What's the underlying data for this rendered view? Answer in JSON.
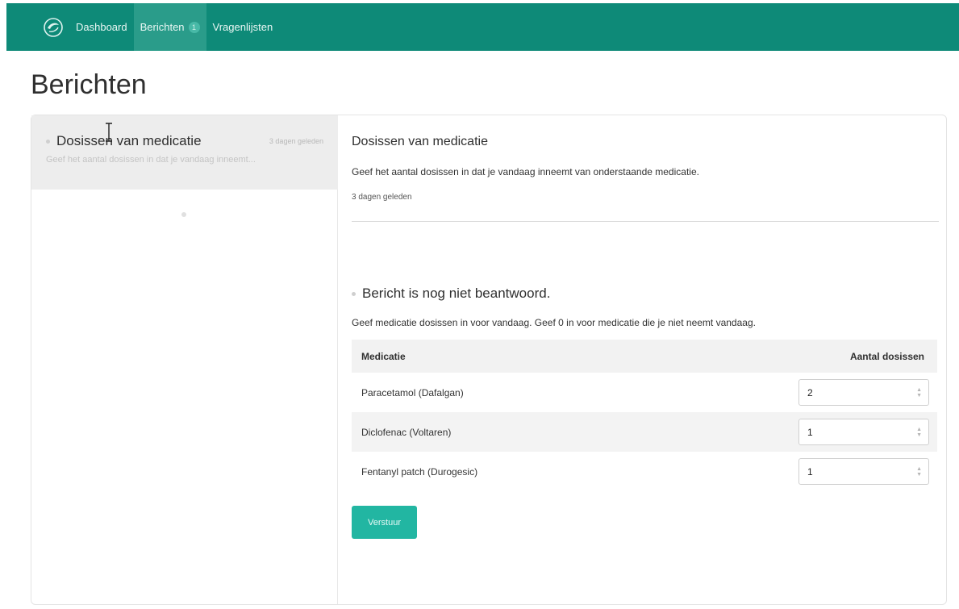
{
  "nav": {
    "brand_icon": "app-logo-icon",
    "items": [
      {
        "label": "Dashboard"
      },
      {
        "label": "Berichten",
        "badge": "1"
      },
      {
        "label": "Vragenlijsten"
      }
    ]
  },
  "page": {
    "title": "Berichten"
  },
  "sidebar": {
    "messages": [
      {
        "title": "Dosissen van medicatie",
        "time": "3 dagen geleden",
        "preview": "Geef het aantal dosissen in dat je vandaag inneemt..."
      }
    ]
  },
  "detail": {
    "title": "Dosissen van medicatie",
    "body": "Geef het aantal dosissen in dat je vandaag inneemt van onderstaande medicatie.",
    "time": "3 dagen geleden",
    "status": "Bericht is nog niet beantwoord.",
    "instructions": "Geef medicatie dosissen in voor vandaag. Geef 0 in voor medicatie die je niet neemt vandaag.",
    "table": {
      "headers": {
        "medication": "Medicatie",
        "doses": "Aantal dosissen"
      },
      "rows": [
        {
          "name": "Paracetamol (Dafalgan)",
          "doses": "2"
        },
        {
          "name": "Diclofenac (Voltaren)",
          "doses": "1"
        },
        {
          "name": "Fentanyl patch (Durogesic)",
          "doses": "1"
        }
      ]
    },
    "submit_label": "Verstuur"
  },
  "colors": {
    "navbar": "#0e8a78",
    "nav_active": "#2a9c8a",
    "button": "#22b6a2"
  }
}
